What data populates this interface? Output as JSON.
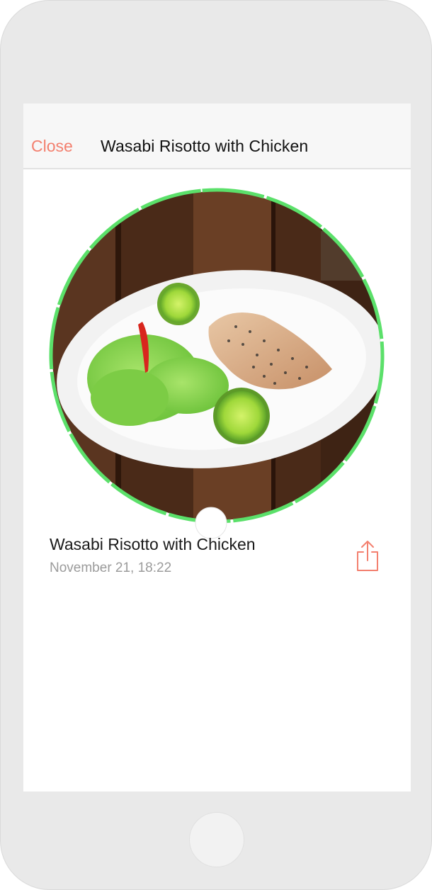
{
  "navbar": {
    "close_label": "Close",
    "title": "Wasabi Risotto with Chicken"
  },
  "meal": {
    "name": "Wasabi Risotto with Chicken",
    "datetime": "November 21, 18:22",
    "photo_description_icon": "food-photo"
  },
  "colors": {
    "accent": "#f3806f",
    "ring": "#5be06a",
    "title_text": "#111111",
    "secondary_text": "#9b9b9b"
  },
  "icons": {
    "share": "share-icon",
    "scrubber": "scrubber-handle"
  }
}
